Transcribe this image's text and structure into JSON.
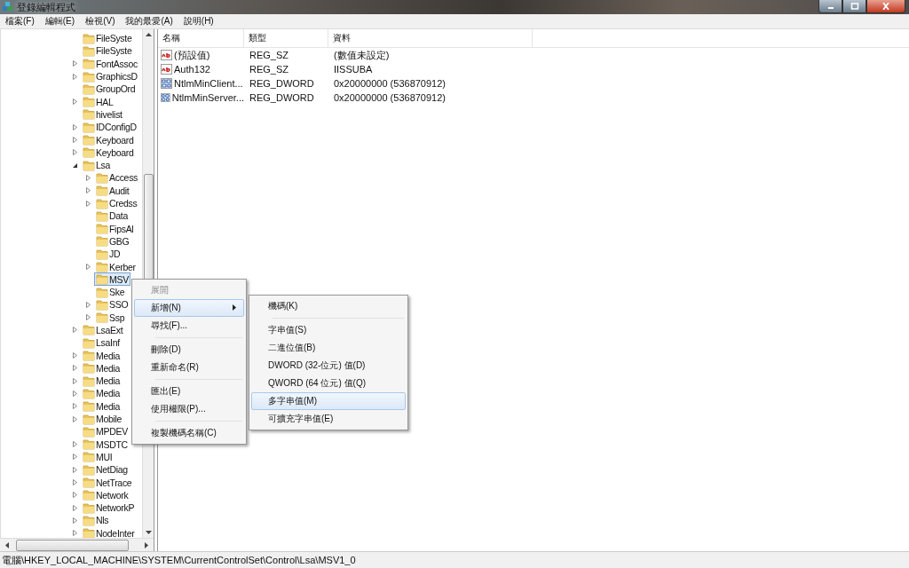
{
  "window": {
    "title": "登錄編輯程式"
  },
  "menu_bar": [
    {
      "label": "檔案(F)"
    },
    {
      "label": "編輯(E)"
    },
    {
      "label": "檢視(V)"
    },
    {
      "label": "我的最愛(A)"
    },
    {
      "label": "說明(H)"
    }
  ],
  "tree": [
    {
      "label": "FileSyste",
      "expandable": false,
      "selected": false
    },
    {
      "label": "FileSyste",
      "expandable": false,
      "selected": false
    },
    {
      "label": "FontAssoc",
      "expandable": true,
      "selected": false
    },
    {
      "label": "GraphicsD",
      "expandable": true,
      "selected": false
    },
    {
      "label": "GroupOrd",
      "expandable": false,
      "selected": false
    },
    {
      "label": "HAL",
      "expandable": true,
      "selected": false
    },
    {
      "label": "hivelist",
      "expandable": false,
      "selected": false
    },
    {
      "label": "IDConfigD",
      "expandable": true,
      "selected": false
    },
    {
      "label": "Keyboard",
      "expandable": true,
      "selected": false
    },
    {
      "label": "Keyboard",
      "expandable": true,
      "selected": false
    },
    {
      "label": "Lsa",
      "expandable": true,
      "expanded": true,
      "selected": false,
      "children": [
        {
          "label": "Access",
          "expandable": true,
          "selected": false
        },
        {
          "label": "Audit",
          "expandable": true,
          "selected": false
        },
        {
          "label": "Credss",
          "expandable": true,
          "selected": false
        },
        {
          "label": "Data",
          "expandable": false,
          "selected": false
        },
        {
          "label": "FipsAl",
          "expandable": false,
          "selected": false
        },
        {
          "label": "GBG",
          "expandable": false,
          "selected": false
        },
        {
          "label": "JD",
          "expandable": false,
          "selected": false
        },
        {
          "label": "Kerber",
          "expandable": true,
          "selected": false
        },
        {
          "label": "MSV",
          "expandable": false,
          "selected": true
        },
        {
          "label": "Ske",
          "expandable": false,
          "selected": false
        },
        {
          "label": "SSO",
          "expandable": true,
          "selected": false
        },
        {
          "label": "Ssp",
          "expandable": true,
          "selected": false
        }
      ]
    },
    {
      "label": "LsaExt",
      "expandable": true,
      "selected": false
    },
    {
      "label": "LsaInf",
      "expandable": false,
      "selected": false
    },
    {
      "label": "Media",
      "expandable": true,
      "selected": false
    },
    {
      "label": "Media",
      "expandable": true,
      "selected": false
    },
    {
      "label": "Media",
      "expandable": true,
      "selected": false
    },
    {
      "label": "Media",
      "expandable": true,
      "selected": false
    },
    {
      "label": "Media",
      "expandable": true,
      "selected": false
    },
    {
      "label": "Mobile",
      "expandable": true,
      "selected": false
    },
    {
      "label": "MPDEV",
      "expandable": false,
      "selected": false
    },
    {
      "label": "MSDTC",
      "expandable": true,
      "selected": false
    },
    {
      "label": "MUI",
      "expandable": true,
      "selected": false
    },
    {
      "label": "NetDiag",
      "expandable": true,
      "selected": false
    },
    {
      "label": "NetTrace",
      "expandable": true,
      "selected": false
    },
    {
      "label": "Network",
      "expandable": true,
      "selected": false
    },
    {
      "label": "NetworkP",
      "expandable": true,
      "selected": false
    },
    {
      "label": "Nls",
      "expandable": true,
      "selected": false
    },
    {
      "label": "NodeInter",
      "expandable": true,
      "selected": false
    }
  ],
  "values_table": {
    "columns": [
      "名稱",
      "類型",
      "資料"
    ],
    "rows": [
      {
        "kind": "string",
        "name": "(預設值)",
        "type": "REG_SZ",
        "data": "(數值未設定)"
      },
      {
        "kind": "string",
        "name": "Auth132",
        "type": "REG_SZ",
        "data": "IISSUBA"
      },
      {
        "kind": "binary",
        "name": "NtlmMinClient...",
        "type": "REG_DWORD",
        "data": "0x20000000 (536870912)"
      },
      {
        "kind": "binary",
        "name": "NtlmMinServer...",
        "type": "REG_DWORD",
        "data": "0x20000000 (536870912)"
      }
    ]
  },
  "context_menu": {
    "items": [
      {
        "kind": "item",
        "label": "展開",
        "disabled": true,
        "selected": false
      },
      {
        "kind": "submenu",
        "label": "新增(N)",
        "disabled": false,
        "selected": true
      },
      {
        "kind": "item",
        "label": "尋找(F)...",
        "disabled": false,
        "selected": false
      },
      {
        "kind": "separator"
      },
      {
        "kind": "item",
        "label": "刪除(D)",
        "disabled": false,
        "selected": false
      },
      {
        "kind": "item",
        "label": "重新命名(R)",
        "disabled": false,
        "selected": false
      },
      {
        "kind": "separator"
      },
      {
        "kind": "item",
        "label": "匯出(E)",
        "disabled": false,
        "selected": false
      },
      {
        "kind": "item",
        "label": "使用權限(P)...",
        "disabled": false,
        "selected": false
      },
      {
        "kind": "separator"
      },
      {
        "kind": "item",
        "label": "複製機碼名稱(C)",
        "disabled": false,
        "selected": false
      }
    ]
  },
  "submenu": {
    "items": [
      {
        "kind": "item",
        "label": "機碼(K)",
        "selected": false
      },
      {
        "kind": "separator"
      },
      {
        "kind": "item",
        "label": "字串值(S)",
        "selected": false
      },
      {
        "kind": "item",
        "label": "二進位值(B)",
        "selected": false
      },
      {
        "kind": "item",
        "label": "DWORD (32-位元) 值(D)",
        "selected": false
      },
      {
        "kind": "item",
        "label": "QWORD (64 位元) 值(Q)",
        "selected": false
      },
      {
        "kind": "item",
        "label": "多字串值(M)",
        "selected": true
      },
      {
        "kind": "item",
        "label": "可擴充字串值(E)",
        "selected": false
      }
    ]
  },
  "status_bar": {
    "path": "電腦\\HKEY_LOCAL_MACHINE\\SYSTEM\\CurrentControlSet\\Control\\Lsa\\MSV1_0"
  }
}
